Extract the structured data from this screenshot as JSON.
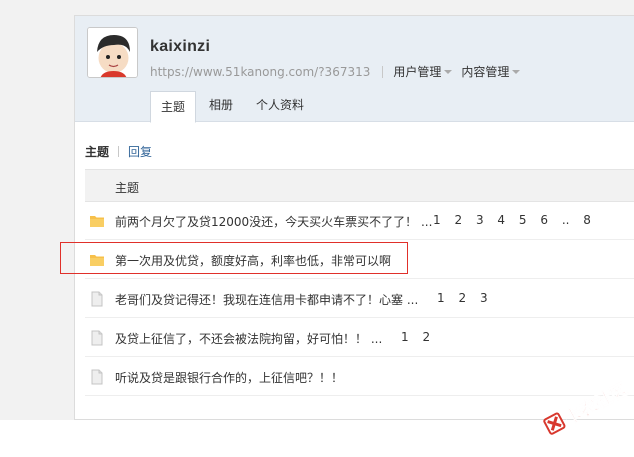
{
  "profile": {
    "username": "kaixinzi",
    "url": "https://www.51kanong.com/?367313",
    "menus": [
      "用户管理",
      "内容管理"
    ]
  },
  "tabs": [
    {
      "label": "主题",
      "active": true
    },
    {
      "label": "相册",
      "active": false
    },
    {
      "label": "个人资料",
      "active": false
    }
  ],
  "subnav": {
    "active": "主题",
    "link": "回复"
  },
  "table": {
    "header": "主题",
    "rows": [
      {
        "title": "前两个月欠了及贷12000没还，今天买火车票买不了了！ ...",
        "pages": [
          "1",
          "2",
          "3",
          "4",
          "5",
          "6",
          "..",
          "8"
        ],
        "icon": "folder-icon"
      },
      {
        "title": "第一次用及优贷，额度好高，利率也低，非常可以啊",
        "pages": [],
        "icon": "folder-icon"
      },
      {
        "title": "老哥们及贷记得还！我现在连信用卡都申请不了！心塞 ...",
        "pages": [
          "1",
          "2",
          "3"
        ],
        "icon": "document-icon"
      },
      {
        "title": "及贷上征信了，不还会被法院拘留，好可怕！！ ...",
        "pages": [
          "1",
          "2"
        ],
        "icon": "document-icon"
      },
      {
        "title": "听说及贷是跟银行合作的，上征信吧？！！",
        "pages": [],
        "icon": "document-icon"
      }
    ]
  },
  "watermark": {
    "text": "卡农社区"
  },
  "colors": {
    "highlight": "#e0302a",
    "folder": "#f7c04a",
    "header_bg": "#e8eef4",
    "link": "#336699"
  }
}
